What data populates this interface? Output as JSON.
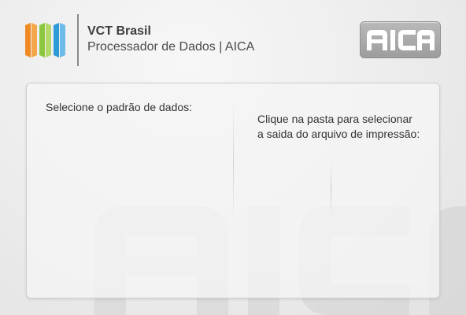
{
  "header": {
    "title": "VCT Brasil",
    "subtitle": "Processador de Dados | AICA",
    "logo_icon": "vct-stripes-logo-icon",
    "badge_icon": "aica-logo-icon",
    "badge_text": "AICA"
  },
  "panel": {
    "data_standard_label": "Selecione o padrão de dados:",
    "output_folder_label_line1": "Clique na pasta para selecionar",
    "output_folder_label_line2": "a saida do arquivo de impressão:"
  },
  "colors": {
    "logo_orange": "#f08a24",
    "logo_green": "#8cc63f",
    "logo_blue": "#2e9bd6",
    "badge_gray": "#a9a9a9"
  }
}
